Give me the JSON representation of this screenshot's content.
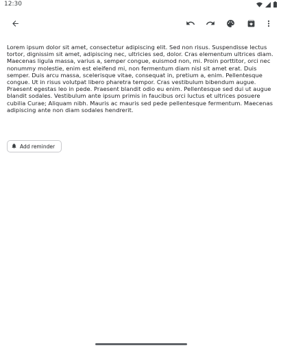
{
  "status_bar": {
    "time": "12:30",
    "icons": [
      "wifi-icon",
      "cellular-icon",
      "battery-icon"
    ]
  },
  "toolbar": {
    "back_icon": "arrow-back-icon",
    "undo_icon": "undo-icon",
    "redo_icon": "redo-icon",
    "palette_icon": "palette-icon",
    "archive_icon": "archive-icon",
    "more_icon": "more-vert-icon"
  },
  "note": {
    "body": "Lorem ipsum dolor sit amet, consectetur adipiscing elit. Sed non risus. Suspendisse lectus tortor, dignissim sit amet, adipiscing nec, ultricies sed, dolor. Cras elementum ultrices diam. Maecenas ligula massa, varius a, semper congue, euismod non, mi. Proin porttitor, orci nec nonummy molestie, enim est eleifend mi, non fermentum diam nisl sit amet erat. Duis semper. Duis arcu massa, scelerisque vitae, consequat in, pretium a, enim. Pellentesque congue. Ut in risus volutpat libero pharetra tempor. Cras vestibulum bibendum augue. Praesent egestas leo in pede. Praesent blandit odio eu enim. Pellentesque sed dui ut augue blandit sodales. Vestibulum ante ipsum primis in faucibus orci luctus et ultrices posuere cubilia Curae; Aliquam nibh. Mauris ac mauris sed pede pellentesque fermentum. Maecenas adipiscing ante non diam sodales hendrerit."
  },
  "reminder": {
    "label": "Add reminder",
    "icon": "bell-icon"
  },
  "colors": {
    "icon": "#3c4043",
    "text": "#202124",
    "chip_border": "#c8c9cc",
    "gesture_bar": "#5f6368"
  }
}
